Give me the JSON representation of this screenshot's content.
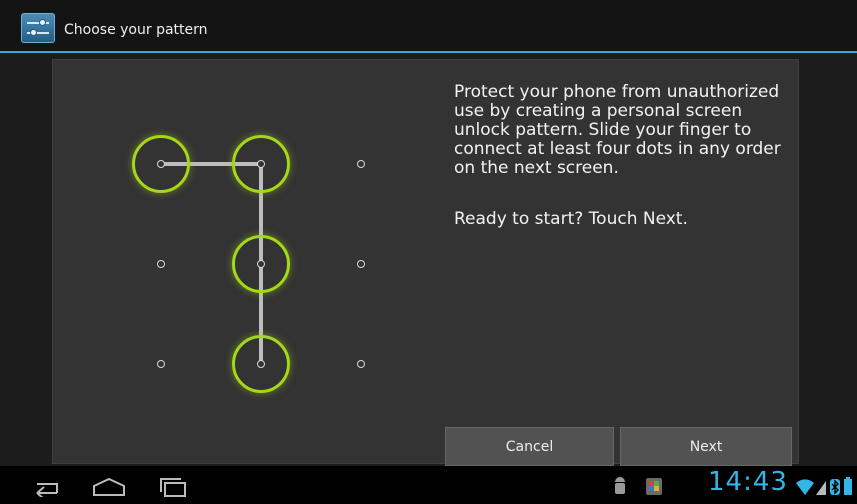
{
  "app": {
    "title": "Choose your pattern",
    "icon": "settings-sliders-icon"
  },
  "pattern": {
    "grid_rows": 3,
    "grid_cols": 3,
    "selected_dots": [
      [
        0,
        0
      ],
      [
        0,
        1
      ],
      [
        1,
        1
      ],
      [
        2,
        1
      ]
    ],
    "accent_color": "#a6d718",
    "line_color": "#bdbdbd"
  },
  "instructions": {
    "description": "Protect your phone from unauthorized use by creating a personal screen unlock pattern. Slide your finger to connect at least four dots in any order on the next screen.",
    "ready": "Ready to start? Touch Next."
  },
  "buttons": {
    "cancel": "Cancel",
    "next": "Next"
  },
  "status_bar": {
    "time": "14:43",
    "accent_color": "#33b5e5",
    "icons": [
      "android-debug-icon",
      "app-notification-icon",
      "wifi-icon",
      "signal-icon",
      "bluetooth-icon",
      "battery-icon"
    ]
  },
  "nav": {
    "icons": [
      "back-icon",
      "home-icon",
      "recent-apps-icon"
    ]
  }
}
